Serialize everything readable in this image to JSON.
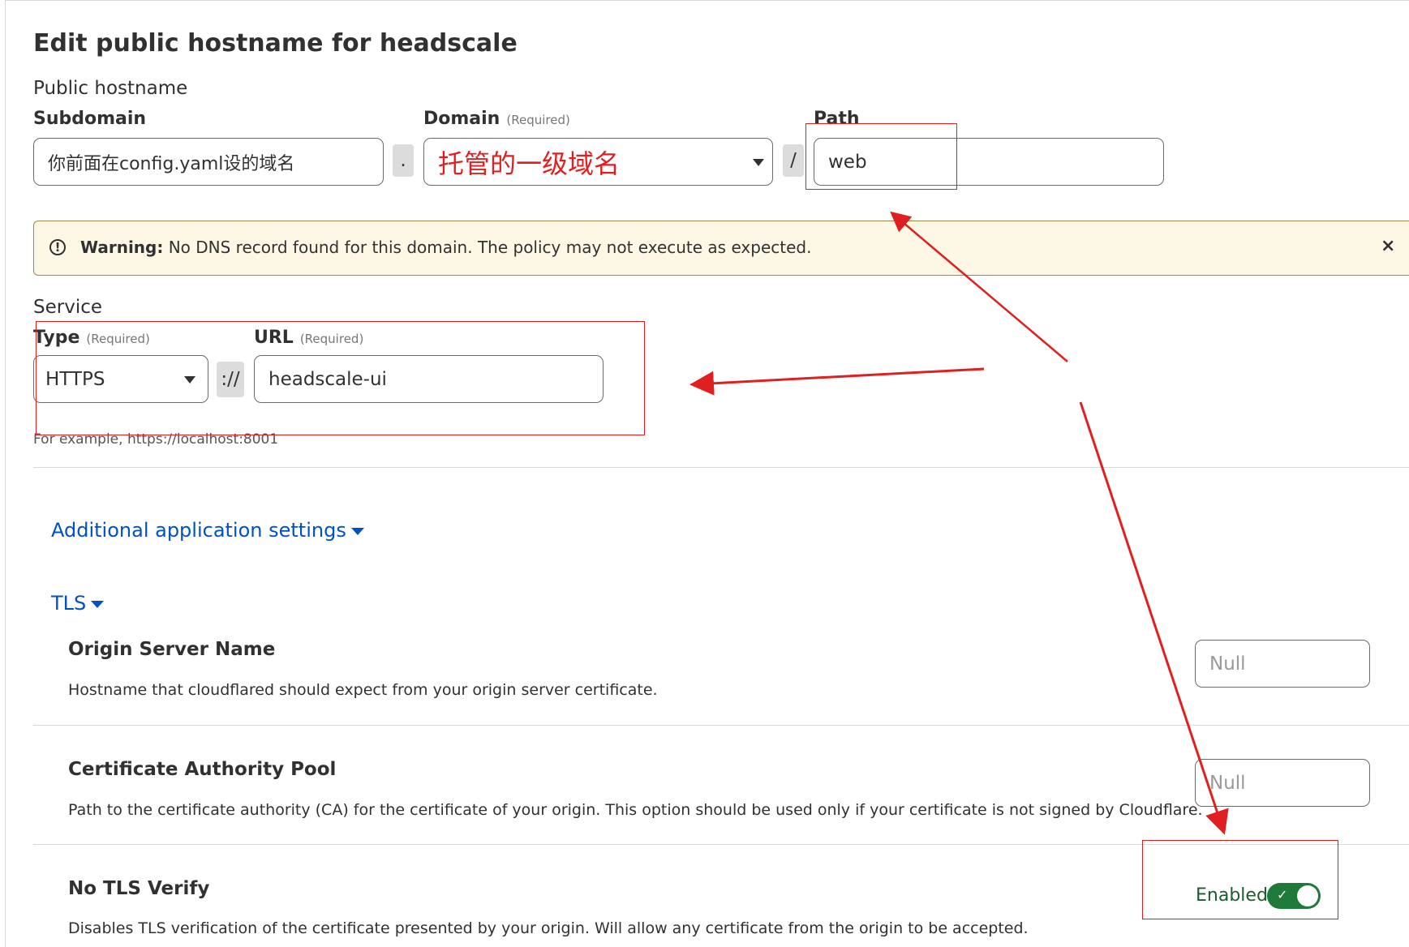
{
  "title": "Edit public hostname for headscale",
  "public_hostname": {
    "section_label": "Public hostname",
    "subdomain": {
      "label": "Subdomain",
      "value": "你前面在config.yaml设的域名"
    },
    "dot_separator": ".",
    "domain": {
      "label": "Domain",
      "required": "(Required)",
      "value": "托管的一级域名",
      "caret_icon": "chevron-down-icon"
    },
    "slash_separator": "/",
    "path": {
      "label": "Path",
      "value": "web"
    }
  },
  "warning": {
    "icon": "exclamation-circle-icon",
    "bold": "Warning:",
    "message": " No DNS record found for this domain. The policy may not execute as expected.",
    "close": "×"
  },
  "service": {
    "section_label": "Service",
    "type": {
      "label": "Type",
      "required": "(Required)",
      "value": "HTTPS"
    },
    "scheme_separator": "://",
    "url": {
      "label": "URL",
      "required": "(Required)",
      "value": "headscale-ui"
    },
    "hint": "For example, https://localhost:8001"
  },
  "additional_settings": {
    "label": "Additional application settings"
  },
  "tls": {
    "label": "TLS",
    "origin_server_name": {
      "title": "Origin Server Name",
      "description": "Hostname that cloudflared should expect from your origin server certificate.",
      "placeholder": "Null"
    },
    "ca_pool": {
      "title": "Certificate Authority Pool",
      "description": "Path to the certificate authority (CA) for the certificate of your origin. This option should be used only if your certificate is not signed by Cloudflare.",
      "placeholder": "Null"
    },
    "no_tls_verify": {
      "title": "No TLS Verify",
      "description": "Disables TLS verification of the certificate presented by your origin. Will allow any certificate from the origin to be accepted.",
      "toggle_label": "Enabled",
      "enabled": true
    }
  },
  "colors": {
    "link": "#0051c3",
    "toggle_on": "#1f7a3a",
    "warning_bg": "#fdf8e6",
    "annotation": "#e02020"
  }
}
